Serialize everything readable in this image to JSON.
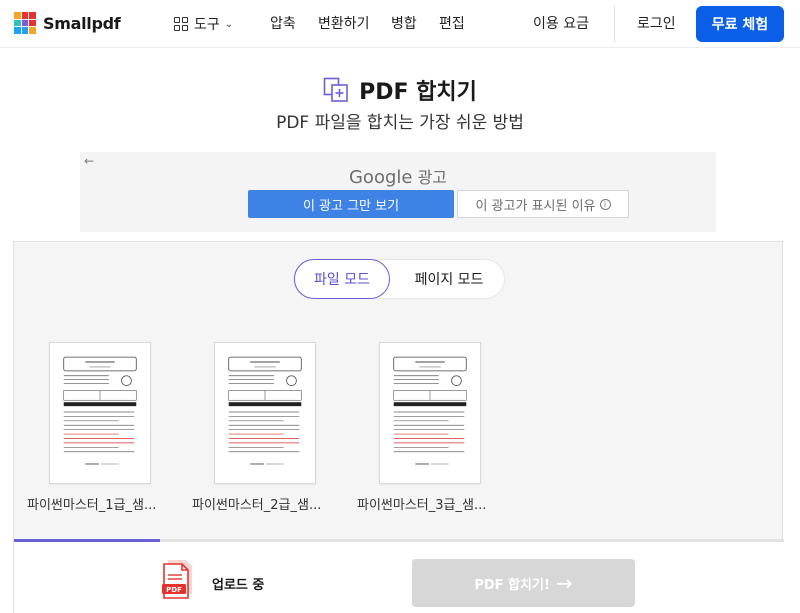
{
  "header": {
    "brand": "Smallpdf",
    "tools_label": "도구",
    "nav": [
      "압축",
      "변환하기",
      "병합",
      "편집"
    ],
    "pricing": "이용 요금",
    "login": "로그인",
    "free_trial": "무료 체험"
  },
  "hero": {
    "title": "PDF 합치기",
    "subtitle": "PDF 파일을 합치는 가장 쉬운 방법"
  },
  "ad": {
    "google": "Google",
    "ad_label": "광고",
    "stop_label": "이 광고 그만 보기",
    "why_label": "이 광고가 표시된 이유"
  },
  "workspace": {
    "mode_file": "파일 모드",
    "mode_page": "페이지 모드",
    "files": [
      {
        "name": "파이썬마스터_1급_샘..."
      },
      {
        "name": "파이썬마스터_2급_샘..."
      },
      {
        "name": "파이썬마스터_3급_샘..."
      }
    ],
    "upload_progress": 0.19,
    "upload_status": "업로드 중",
    "pdf_badge": "PDF",
    "merge_button": "PDF 합치기!"
  },
  "colors": {
    "primary": "#0b5ee8",
    "accent": "#6b5fd8",
    "disabled": "#d7d7d7",
    "pdf_red": "#e5322d"
  }
}
